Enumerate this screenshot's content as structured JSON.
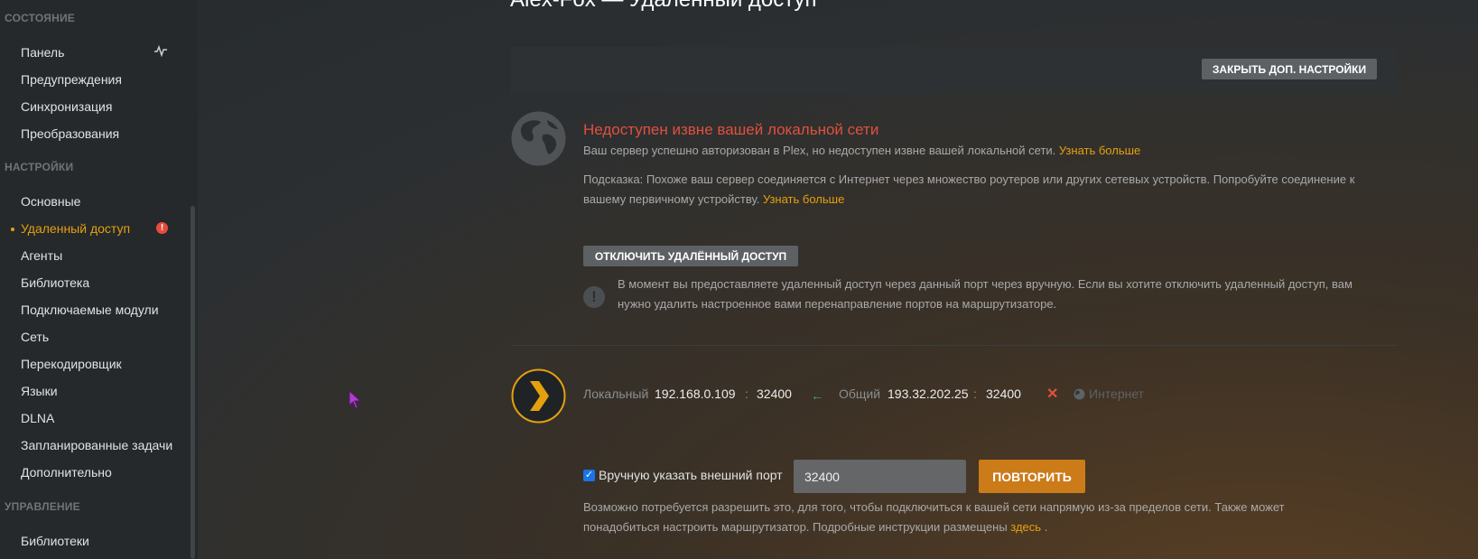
{
  "sidebar": {
    "sections": [
      {
        "header": "Состояние",
        "items": [
          {
            "label": "Панель",
            "icon": "pulse-icon"
          },
          {
            "label": "Предупреждения"
          },
          {
            "label": "Синхронизация"
          },
          {
            "label": "Преобразования"
          }
        ]
      },
      {
        "header": "Настройки",
        "items": [
          {
            "label": "Основные"
          },
          {
            "label": "Удаленный доступ",
            "active": true,
            "badge": "!"
          },
          {
            "label": "Агенты"
          },
          {
            "label": "Библиотека"
          },
          {
            "label": "Подключаемые модули"
          },
          {
            "label": "Сеть"
          },
          {
            "label": "Перекодировщик"
          },
          {
            "label": "Языки"
          },
          {
            "label": "DLNA"
          },
          {
            "label": "Запланированные задачи"
          },
          {
            "label": "Дополнительно"
          }
        ]
      },
      {
        "header": "Управление",
        "items": [
          {
            "label": "Библиотеки"
          }
        ]
      }
    ]
  },
  "main": {
    "title": "Alex-Fox — Удаленный доступ",
    "close_button": "ЗАКРЫТЬ ДОП. НАСТРОЙКИ",
    "status": {
      "title": "Недоступен извне вашей локальной сети",
      "description": "Ваш сервер успешно авторизован в Plex, но недоступен извне вашей локальной сети.",
      "learn_more": "Узнать больше",
      "hint_line1": "Подсказка: Похоже ваш сервер соединяется с Интернет через множество роутеров или других сетевых устройств. Попробуйте соединение к",
      "hint_line2": "вашему первичному устройству.",
      "hint_learn_more": "Узнать больше"
    },
    "disable_button": "ОТКЛЮЧИТЬ УДАЛЁННЫЙ ДОСТУП",
    "warning_line1": "В момент вы предоставляете удаленный доступ через данный порт через вручную. Если вы хотите отключить удаленный доступ, вам",
    "warning_line2": "нужно удалить настроенное вами перенаправление портов на маршрутизаторе.",
    "connection": {
      "local_label": "Локальный",
      "local_ip": "192.168.0.109",
      "local_port": "32400",
      "public_label": "Общий",
      "public_ip": "193.32.202.25",
      "public_port": "32400",
      "internet_label": "Интернет",
      "separator": ":"
    },
    "manual_port": {
      "checkbox_label": "Вручную указать внешний порт",
      "checked": true,
      "value": "32400",
      "retry_button": "ПОВТОРИТЬ",
      "note_line1": "Возможно потребуется разрешить это, для того, чтобы подключиться к вашей сети напрямую из-за пределов сети. Также может",
      "note_line2": "понадобиться настроить маршрутизатор. Подробные инструкции размещены",
      "note_link": "здесь",
      "note_end": "."
    }
  },
  "colors": {
    "accent": "#e5a00d",
    "error": "#e0503f",
    "success": "#4caf50"
  }
}
